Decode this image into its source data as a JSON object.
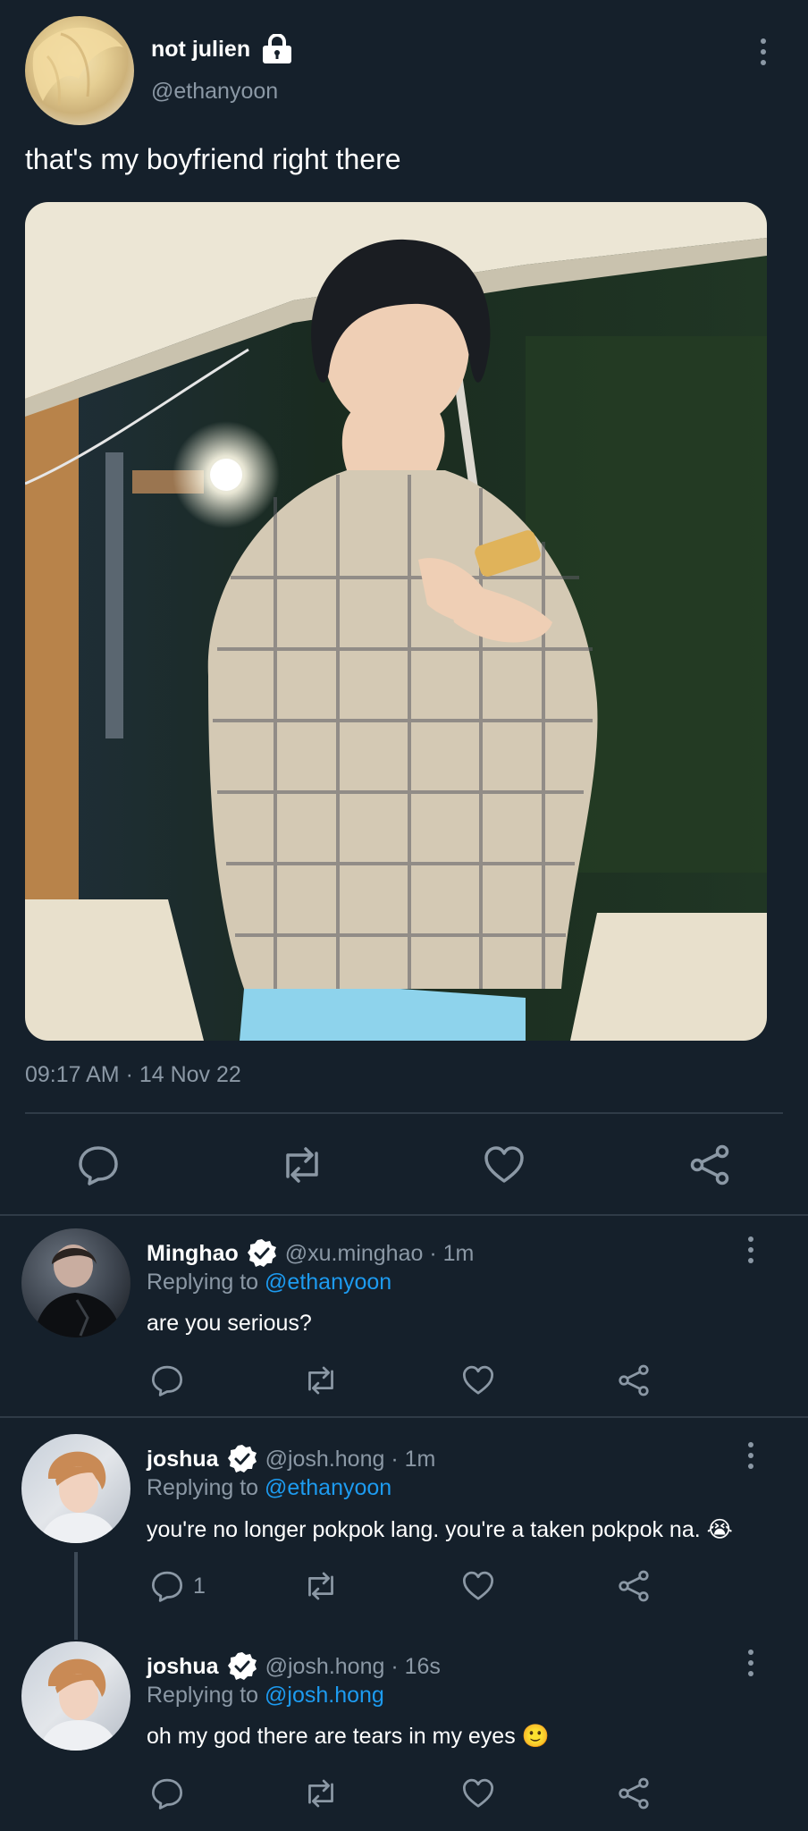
{
  "main_tweet": {
    "display_name": "not julien",
    "handle": "@ethanyoon",
    "text": "that's my boyfriend right there",
    "timestamp": "09:17 AM · 14 Nov 22"
  },
  "replies": [
    {
      "display_name": "Minghao",
      "handle_time": "@xu.minghao · 1m",
      "replying_prefix": "Replying to",
      "replying_to": "@ethanyoon",
      "text": "are you serious?",
      "reply_count": ""
    },
    {
      "display_name": "joshua",
      "handle_time": "@josh.hong · 1m",
      "replying_prefix": "Replying to",
      "replying_to": "@ethanyoon",
      "text": "you're no longer pokpok lang. you're a taken pokpok na. 😭",
      "reply_count": "1"
    },
    {
      "display_name": "joshua",
      "handle_time": "@josh.hong · 16s",
      "replying_prefix": "Replying to",
      "replying_to": "@josh.hong",
      "text": "oh my god there are tears in my eyes 🙂",
      "reply_count": ""
    }
  ],
  "colors": {
    "background": "#15202b",
    "muted": "#8b98a5",
    "link": "#1d9bf0",
    "divider": "#2f3b47"
  },
  "icons": [
    "lock-icon",
    "more-options-icon",
    "reply-icon",
    "retweet-icon",
    "like-icon",
    "share-icon",
    "verified-badge-icon"
  ]
}
